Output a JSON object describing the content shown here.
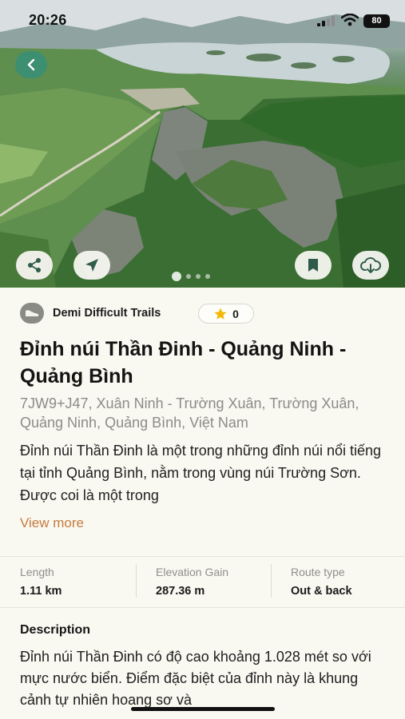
{
  "status_bar": {
    "time": "20:26",
    "battery": "80"
  },
  "gallery": {
    "page_count": 4,
    "active_index": 0
  },
  "category": {
    "label": "Demi Difficult Trails"
  },
  "rating": {
    "value": "0"
  },
  "trail": {
    "title": "Đỉnh núi Thần Đinh - Quảng Ninh - Quảng Bình",
    "address": "7JW9+J47, Xuân Ninh - Trường Xuân, Trường Xuân, Quảng Ninh, Quảng Bình, Việt Nam",
    "summary": "Đỉnh núi Thần Đinh là một trong những đỉnh núi nổi tiếng tại tỉnh Quảng Bình, nằm trong vùng núi Trường Sơn. Được coi là một trong",
    "view_more": "View more"
  },
  "stats": [
    {
      "label": "Length",
      "value": "1.11 km"
    },
    {
      "label": "Elevation Gain",
      "value": "287.36 m"
    },
    {
      "label": "Route type",
      "value": "Out & back"
    }
  ],
  "description": {
    "heading": "Description",
    "body": "Đỉnh núi Thần Đinh có độ cao khoảng 1.028 mét so với mực nước biển. Điểm đặc biệt của đỉnh này là khung cảnh tự nhiên hoang sơ và"
  },
  "icons": {
    "back": "chevron-left-icon",
    "share": "share-icon",
    "navigate": "navigation-arrow-icon",
    "bookmark": "bookmark-icon",
    "download": "cloud-download-icon",
    "category": "shoe-icon",
    "star": "star-icon"
  },
  "colors": {
    "accent": "#3d8f72",
    "link": "#c77b3f",
    "star": "#f5b800"
  }
}
